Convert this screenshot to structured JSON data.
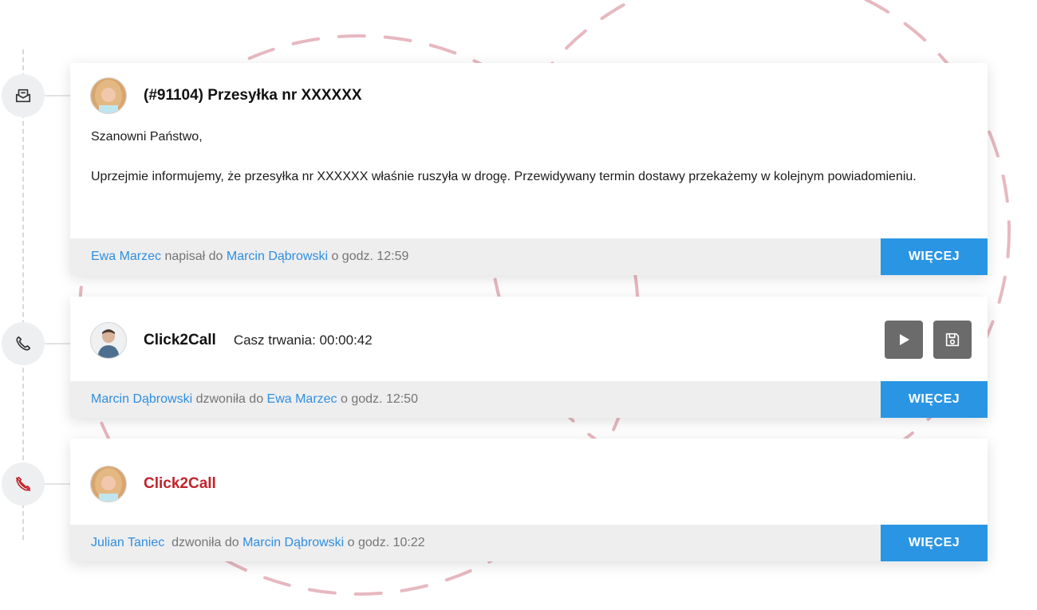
{
  "timeline": {
    "nodes": [
      {
        "icon": "envelope-icon"
      },
      {
        "icon": "phone-icon"
      },
      {
        "icon": "missed-call-icon"
      }
    ]
  },
  "colors": {
    "link": "#2f8ee0",
    "button": "#2a96e3",
    "missed": "#c1232b",
    "decoration": "#e7b8c0"
  },
  "cards": [
    {
      "avatar": "avatar-woman",
      "title": "(#91104) Przesyłka nr XXXXXX",
      "body": [
        "Szanowni Państwo,",
        "Uprzejmie informujemy, że przesyłka nr XXXXXX właśnie ruszyła w drogę. Przewidywany termin dostawy przekażemy w kolejnym powiadomieniu."
      ],
      "footer": {
        "from": "Ewa Marzec",
        "action": " napisał do ",
        "to": "Marcin Dąbrowski",
        "time": " o godz. 12:59"
      },
      "more_label": "WIĘCEJ"
    },
    {
      "avatar": "avatar-man",
      "title": "Click2Call",
      "duration": "Casz trwania: 00:00:42",
      "footer": {
        "from": "Marcin Dąbrowski",
        "action": " dzwoniła do ",
        "to": "Ewa Marzec",
        "time": " o godz. 12:50"
      },
      "more_label": "WIĘCEJ"
    },
    {
      "avatar": "avatar-woman",
      "title": "Click2Call",
      "footer": {
        "from": "Julian Taniec",
        "action": "  dzwoniła do ",
        "to": "Marcin Dąbrowski",
        "time": " o godz. 10:22"
      },
      "more_label": "WIĘCEJ"
    }
  ]
}
